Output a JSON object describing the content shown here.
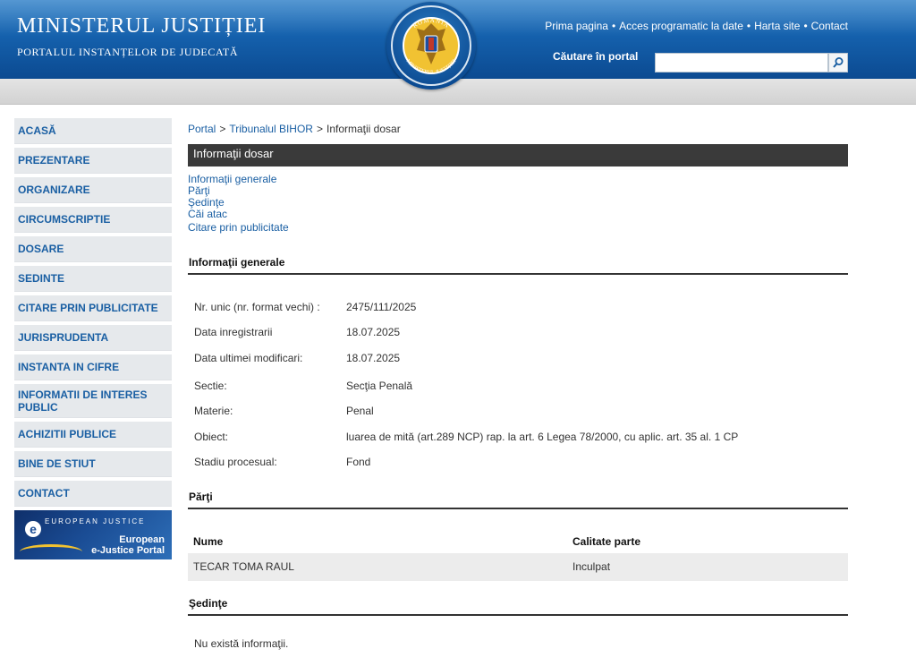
{
  "header": {
    "title": "MINISTERUL JUSTIȚIEI",
    "subtitle": "PORTALUL INSTANȚELOR DE JUDECATĂ",
    "logo_arc_top": "ROMANIA",
    "logo_arc_bottom": "MINISTERUL JUSTIȚIEI",
    "links": [
      "Prima pagina",
      "Acces programatic la date",
      "Harta site",
      "Contact"
    ],
    "search_label": "Căutare în portal",
    "search_value": "",
    "colors": {
      "header_blue": "#1561ad",
      "link_blue": "#1a5fa3",
      "bar_dark": "#3a3a3a",
      "sidebar_bg": "#e6e9ec"
    }
  },
  "sidebar": {
    "items": [
      {
        "label": "ACASĂ"
      },
      {
        "label": "PREZENTARE"
      },
      {
        "label": "ORGANIZARE"
      },
      {
        "label": "CIRCUMSCRIPTIE"
      },
      {
        "label": "DOSARE"
      },
      {
        "label": "SEDINTE"
      },
      {
        "label": "CITARE PRIN PUBLICITATE"
      },
      {
        "label": "JURISPRUDENTA"
      },
      {
        "label": "INSTANTA IN CIFRE"
      },
      {
        "label": "INFORMATII DE INTERES PUBLIC"
      },
      {
        "label": "ACHIZITII PUBLICE"
      },
      {
        "label": "BINE DE STIUT"
      },
      {
        "label": "CONTACT"
      }
    ],
    "ejustice": {
      "logo_text": "EUROPEAN JUSTICE",
      "name_line1": "European",
      "name_line2": "e-Justice Portal"
    }
  },
  "breadcrumb": {
    "portal": "Portal",
    "court": "Tribunalul BIHOR",
    "current": "Informaţii dosar",
    "sep": ">"
  },
  "page_title": "Informaţii dosar",
  "anchors": [
    "Informaţii generale",
    "Părţi",
    "Şedinţe",
    "Căi atac",
    "Citare prin publicitate"
  ],
  "info_general": {
    "heading": "Informaţii generale",
    "rows": [
      {
        "label": "Nr. unic (nr. format vechi) :",
        "value": "2475/111/2025"
      },
      {
        "label": "Data inregistrarii",
        "value": "18.07.2025"
      },
      {
        "label": "Data ultimei modificari:",
        "value": "18.07.2025"
      },
      {
        "label": "Sectie:",
        "value": "Secţia Penală"
      },
      {
        "label": "Materie:",
        "value": "Penal"
      },
      {
        "label": "Obiect:",
        "value": "luarea de mită (art.289 NCP) rap. la art. 6 Legea 78/2000, cu aplic. art. 35 al. 1 CP"
      },
      {
        "label": "Stadiu procesual:",
        "value": "Fond"
      }
    ]
  },
  "parti": {
    "heading": "Părţi",
    "columns": [
      "Nume",
      "Calitate parte"
    ],
    "rows": [
      {
        "name": "TECAR TOMA RAUL",
        "role": "Inculpat"
      }
    ]
  },
  "sedinte": {
    "heading": "Şedinţe",
    "empty": "Nu există informaţii."
  }
}
